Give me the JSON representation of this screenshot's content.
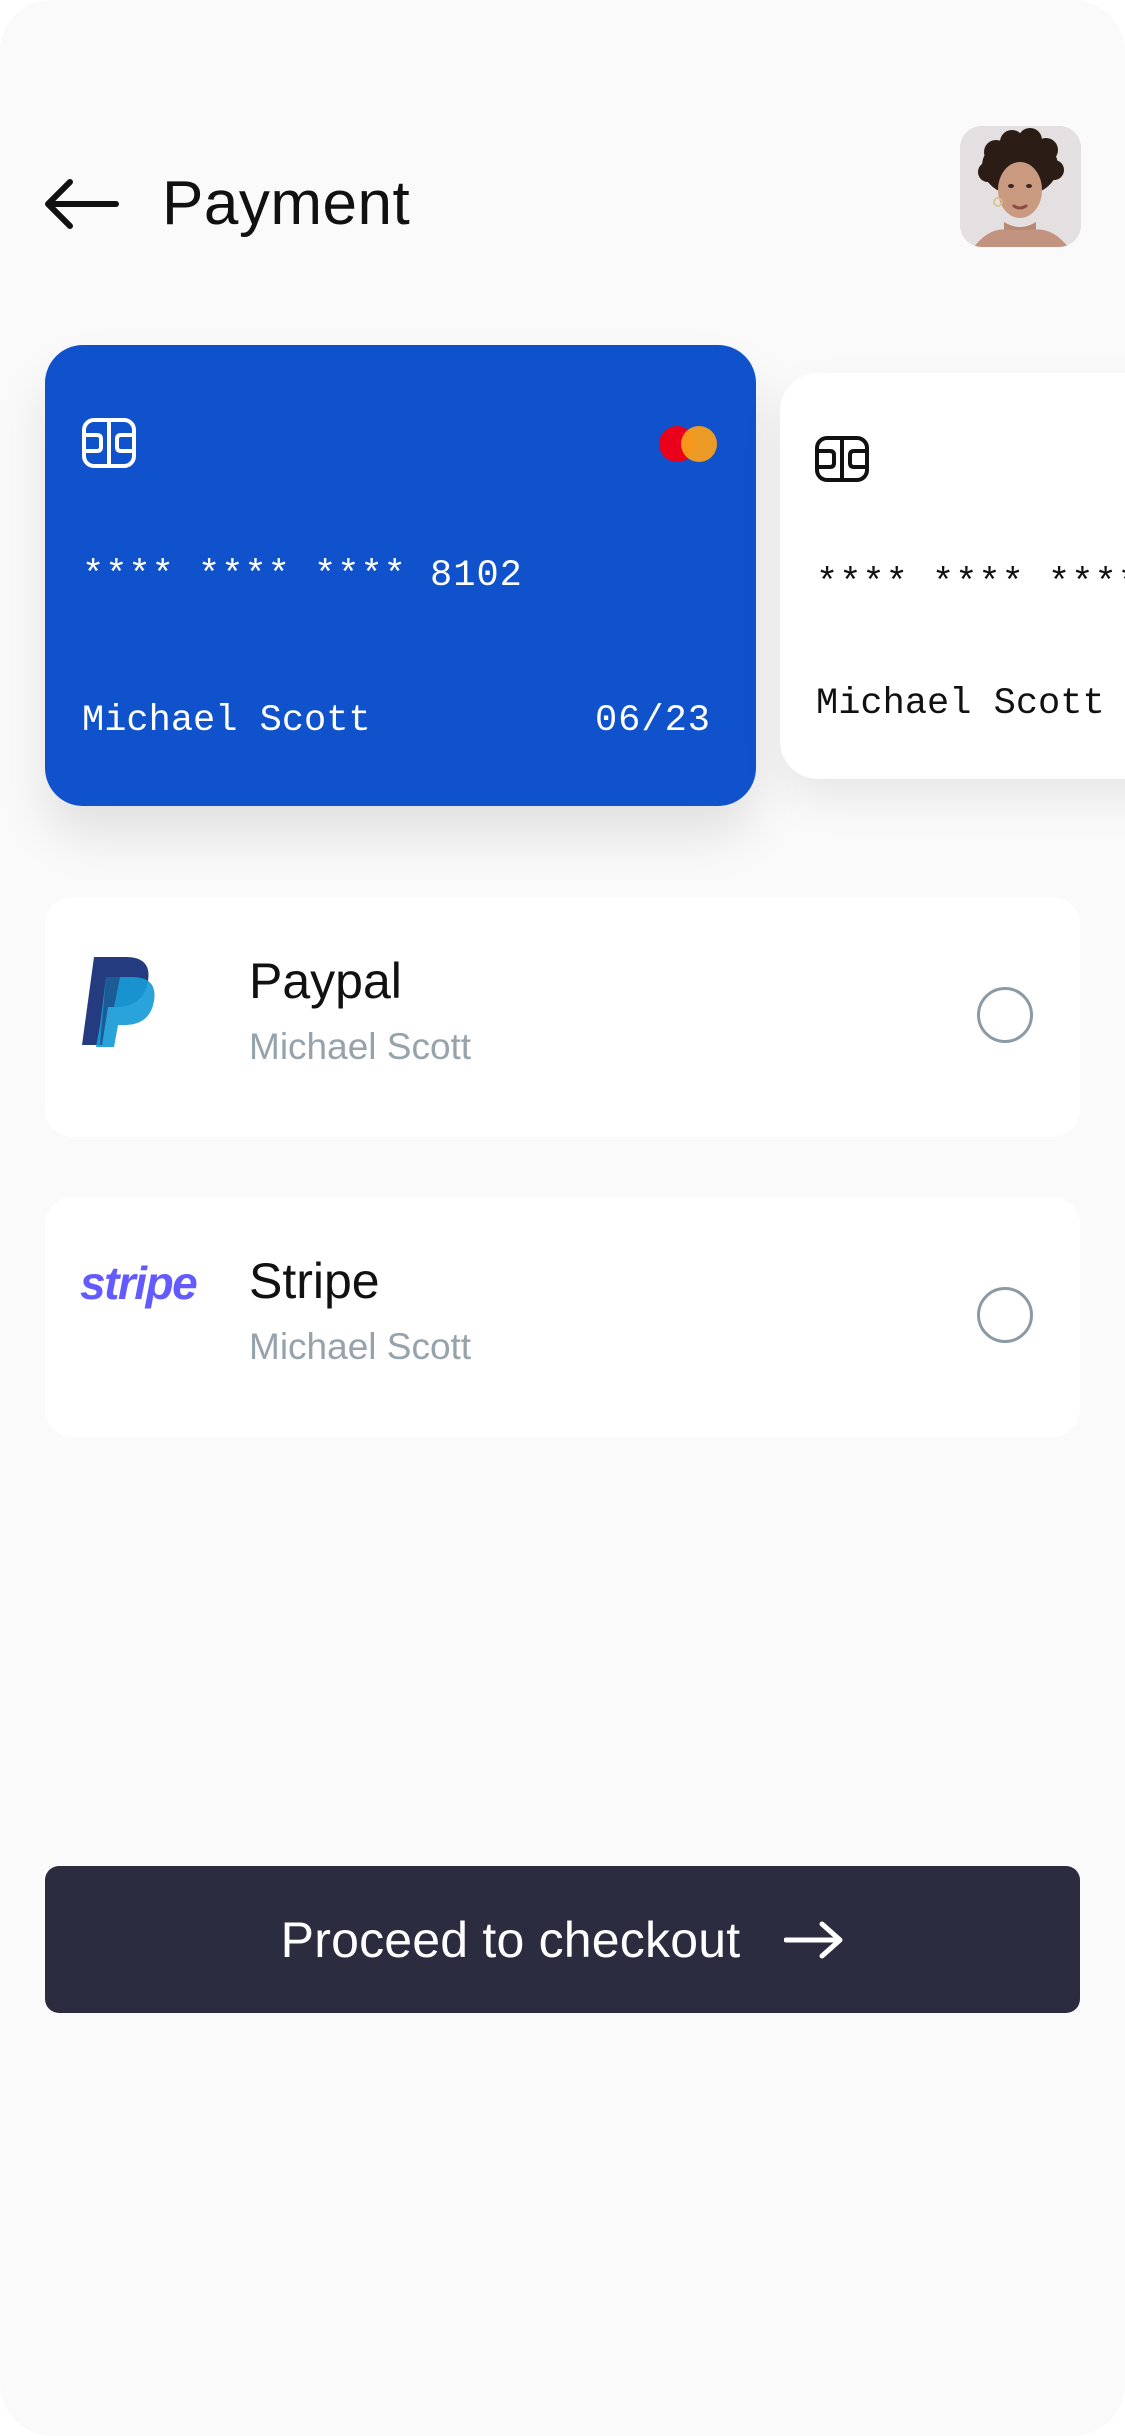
{
  "header": {
    "title": "Payment",
    "back_icon": "arrow-left-icon",
    "avatar_alt": ""
  },
  "cards": [
    {
      "number": "**** **** **** 8102",
      "holder": "Michael Scott",
      "expiry": "06/23",
      "brand": "mastercard",
      "color": "#0f52cc",
      "selected": true
    },
    {
      "number": "**** **** ****",
      "holder": "Michael Scott",
      "color": "#ffffff",
      "selected": false
    }
  ],
  "methods": [
    {
      "name": "Paypal",
      "account": "Michael Scott",
      "logo": "paypal-logo",
      "selected": false
    },
    {
      "name": "Stripe",
      "account": "Michael Scott",
      "logo_text": "stripe",
      "selected": false
    }
  ],
  "checkout": {
    "label": "Proceed to checkout",
    "icon": "arrow-right-icon"
  },
  "colors": {
    "background": "#fafafa",
    "card_primary": "#0f52cc",
    "button": "#2c2c40",
    "muted_text": "#97a3ab",
    "stripe_brand": "#635bff"
  }
}
